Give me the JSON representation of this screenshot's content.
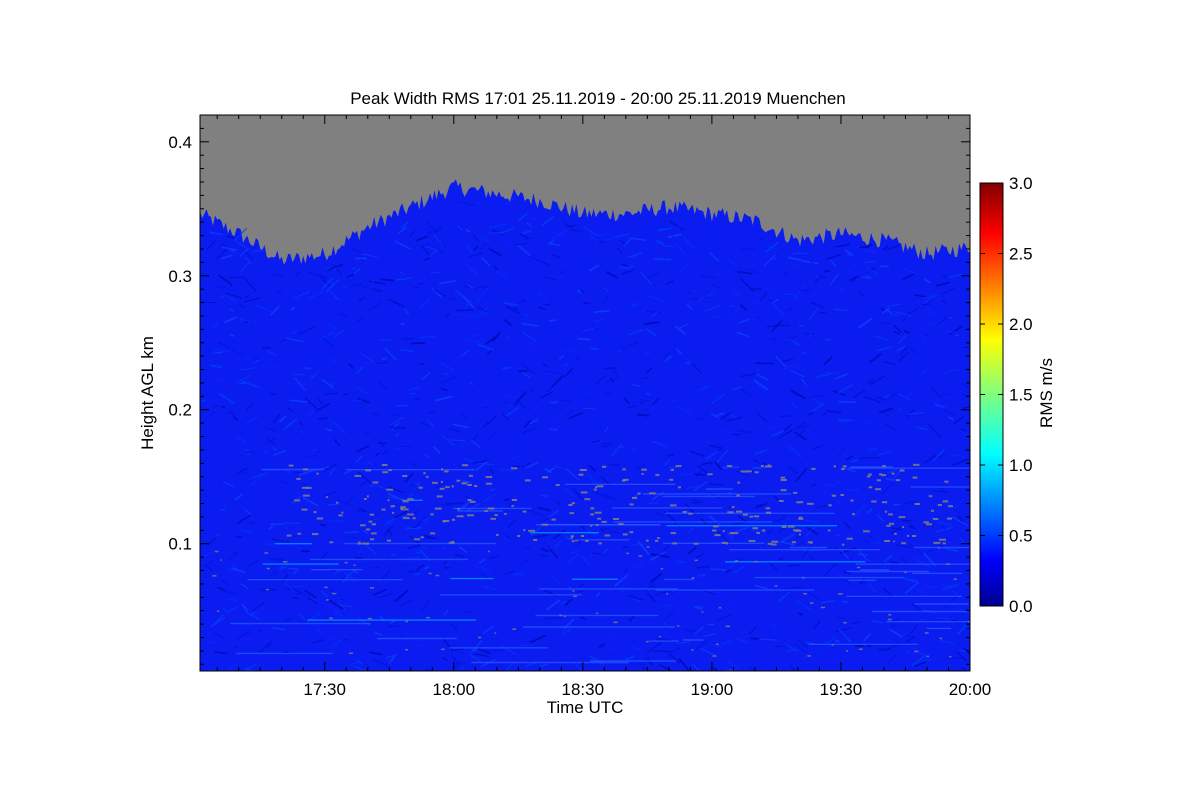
{
  "chart_data": {
    "type": "heatmap",
    "title": "Peak Width RMS   17:01 25.11.2019 - 20:00 25.11.2019 Muenchen",
    "xlabel": "Time UTC",
    "ylabel": "Height AGL km",
    "xlim": [
      "17:01",
      "20:00"
    ],
    "ylim": [
      0.005,
      0.42
    ],
    "x_ticks": [
      "17:30",
      "18:00",
      "18:30",
      "19:00",
      "19:30",
      "20:00"
    ],
    "y_ticks": [
      "0.1",
      "0.2",
      "0.3",
      "0.4"
    ],
    "colorbar": {
      "label": "RMS m/s",
      "range": [
        0.0,
        3.0
      ],
      "ticks": [
        "0.0",
        "0.5",
        "1.0",
        "1.5",
        "2.0",
        "2.5",
        "3.0"
      ],
      "colormap": "jet"
    },
    "dominant_value_range": [
      0.2,
      0.6
    ],
    "no_data_color": "#808080",
    "grid": false,
    "legend_position": "right",
    "data_top_boundary_km": {
      "time": [
        "17:01",
        "17:10",
        "17:20",
        "17:30",
        "17:40",
        "17:50",
        "18:00",
        "18:10",
        "18:20",
        "18:30",
        "18:40",
        "18:50",
        "19:00",
        "19:10",
        "19:20",
        "19:30",
        "19:40",
        "19:50",
        "20:00"
      ],
      "height": [
        0.345,
        0.33,
        0.31,
        0.315,
        0.335,
        0.35,
        0.365,
        0.36,
        0.355,
        0.345,
        0.345,
        0.35,
        0.345,
        0.34,
        0.325,
        0.33,
        0.325,
        0.315,
        0.32
      ]
    },
    "missing_value_bands_km": [
      0.1,
      0.16
    ]
  }
}
